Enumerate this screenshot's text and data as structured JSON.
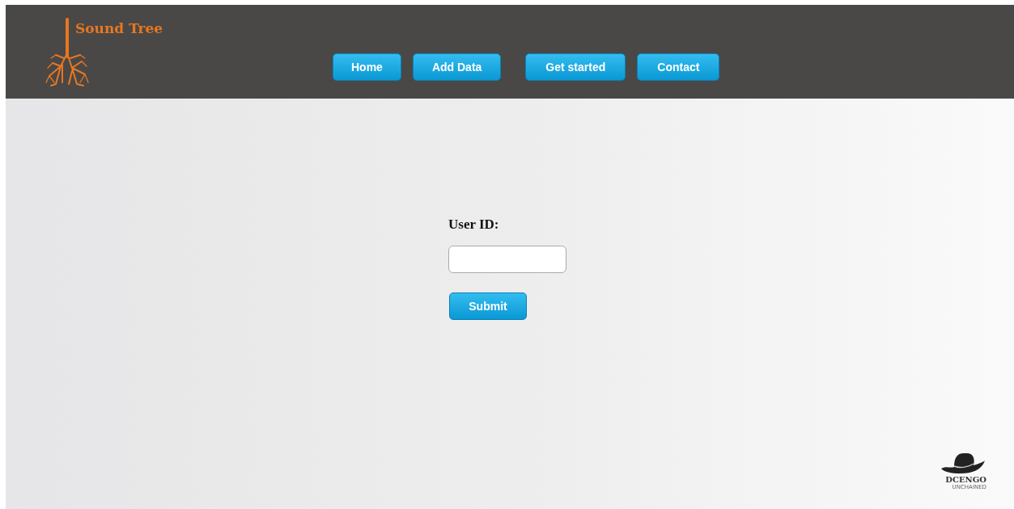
{
  "brand": {
    "name": "Sound Tree"
  },
  "nav": [
    {
      "label": "Home"
    },
    {
      "label": "Add Data"
    },
    {
      "label": "Get started"
    },
    {
      "label": "Contact"
    }
  ],
  "form": {
    "label": "User ID:",
    "submit": "Submit"
  },
  "footer_logo": {
    "name": "DCENGO",
    "tagline": "UNCHAINED"
  }
}
